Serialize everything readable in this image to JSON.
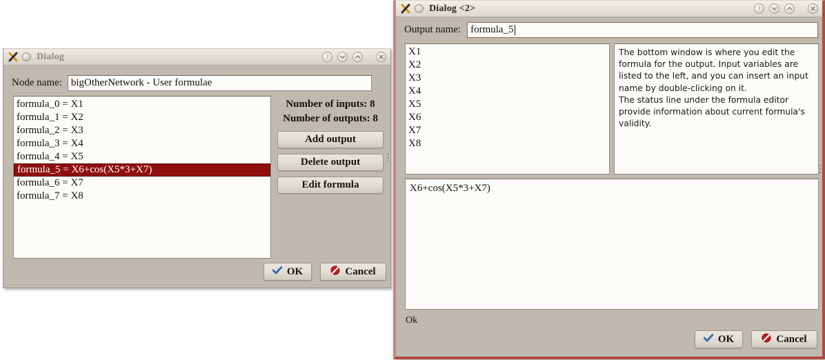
{
  "left_dialog": {
    "title": "Dialog",
    "focused": false,
    "icons": {
      "app": "x11-logo-icon",
      "menu": "window-menu-icon",
      "help": "help-icon",
      "shade": "shade-icon",
      "maximize": "maximize-icon",
      "close": "close-icon"
    },
    "node_name_label": "Node name:",
    "node_name_value": "bigOtherNetwork - User formulae",
    "formula_list": [
      {
        "text": "formula_0 = X1",
        "selected": false
      },
      {
        "text": "formula_1 = X2",
        "selected": false
      },
      {
        "text": "formula_2 = X3",
        "selected": false
      },
      {
        "text": "formula_3 = X4",
        "selected": false
      },
      {
        "text": "formula_4 = X5",
        "selected": false
      },
      {
        "text": "formula_5 = X6+cos(X5*3+X7)",
        "selected": true
      },
      {
        "text": "formula_6 = X7",
        "selected": false
      },
      {
        "text": "formula_7 = X8",
        "selected": false
      }
    ],
    "inputs_label": "Number of inputs: 8",
    "outputs_label": "Number of outputs: 8",
    "add_output_label": "Add output",
    "delete_output_label": "Delete output",
    "edit_formula_label": "Edit formula",
    "ok_label": "OK",
    "cancel_label": "Cancel"
  },
  "right_dialog": {
    "title": "Dialog <2>",
    "focused": true,
    "icons": {
      "app": "x11-logo-icon",
      "menu": "window-menu-icon",
      "help": "help-icon",
      "shade": "shade-icon",
      "maximize": "maximize-icon",
      "close": "close-icon"
    },
    "output_name_label": "Output name:",
    "output_name_value": "formula_5",
    "variables": [
      "X1",
      "X2",
      "X3",
      "X4",
      "X5",
      "X6",
      "X7",
      "X8"
    ],
    "help_text": "The bottom window is where you edit the formula for the output. Input variables are listed to the left, and you can insert an input name by double-clicking on it.\nThe status line under the formula editor provide information about current formula's validity.",
    "formula_value": "X6+cos(X5*3+X7)",
    "status_label": "Ok",
    "ok_label": "OK",
    "cancel_label": "Cancel"
  },
  "colors": {
    "dialog_background": "#bfb9af",
    "field_background": "#fdfcf8",
    "selection_background": "#8f0f0f",
    "selection_text": "#ffffff",
    "focused_border": "#b04b43",
    "ok_icon": "#3a6ea5",
    "cancel_icon": "#c01c1c"
  }
}
